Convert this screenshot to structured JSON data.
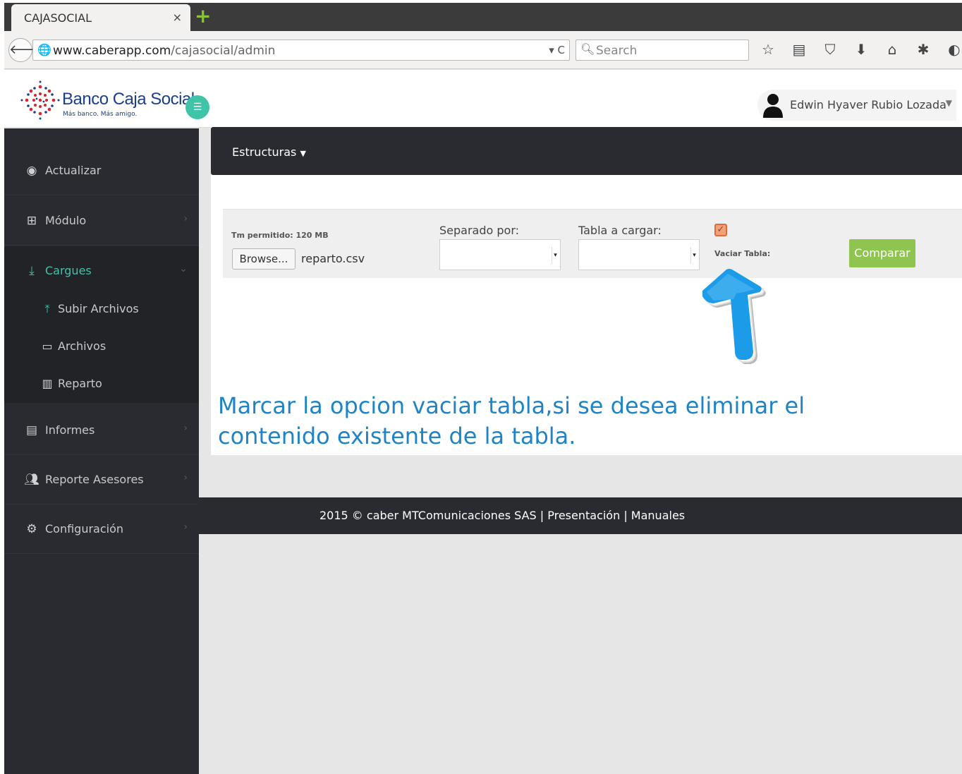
{
  "browser": {
    "tab_title": "CAJASOCIAL",
    "tab_close": "×",
    "new_tab": "+",
    "url_host": "www.caberapp.com",
    "url_path": "/cajasocial/admin",
    "url_tools": "▾ C",
    "search_placeholder": "Search"
  },
  "header": {
    "brand": "Banco Caja Social",
    "tagline": "Más banco. Más amigo.",
    "user_name": "Edwin Hyaver Rubio Lozada"
  },
  "sidebar": {
    "items": [
      {
        "label": "Actualizar",
        "icon": "dashboard-icon"
      },
      {
        "label": "Módulo",
        "icon": "sitemap-icon"
      },
      {
        "label": "Cargues",
        "icon": "download-icon"
      },
      {
        "label": "Informes",
        "icon": "list-icon"
      },
      {
        "label": "Reporte Asesores",
        "icon": "users-icon"
      },
      {
        "label": "Configuración",
        "icon": "gears-icon"
      }
    ],
    "subitems": [
      {
        "label": "Subir Archivos",
        "icon": "upload-icon"
      },
      {
        "label": "Archivos",
        "icon": "inbox-icon"
      },
      {
        "label": "Reparto",
        "icon": "bar-chart-icon"
      }
    ]
  },
  "topnav": {
    "estructuras": "Estructuras"
  },
  "form": {
    "limit_label": "Tm permitido: 120 MB",
    "browse_label": "Browse...",
    "file_name": "reparto.csv",
    "separator_label": "Separado por:",
    "table_label": "Tabla a cargar:",
    "vaciar_label": "Vaciar Tabla:",
    "vaciar_checked": true,
    "compare_label": "Comparar"
  },
  "annotation": {
    "line1": "Marcar la opcion vaciar tabla,si se desea eliminar el",
    "line2": "contenido existente de la tabla."
  },
  "footer": {
    "text": "2015 © caber MTComunicaciones SAS | Presentación | Manuales"
  },
  "colors": {
    "accent": "#3fc4a8",
    "sidebar_bg": "#2a2b30",
    "compare_btn": "#8fc450",
    "annotation_blue": "#1f84c6",
    "brand_blue": "#1b3f8b"
  }
}
